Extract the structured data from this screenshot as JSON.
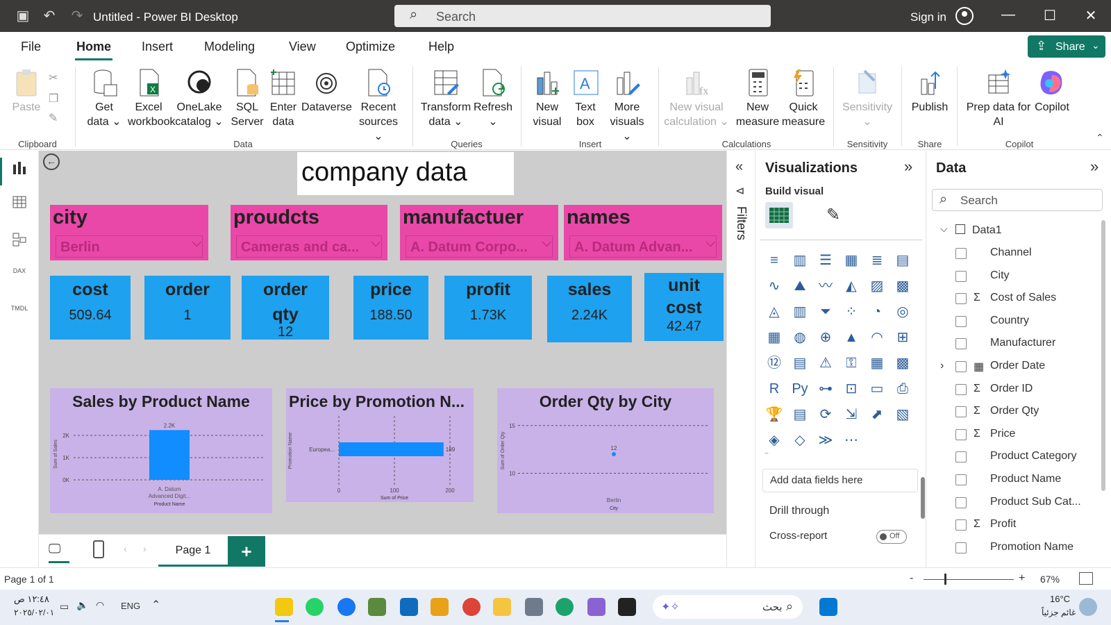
{
  "window": {
    "title": "Untitled - Power BI Desktop",
    "search_placeholder": "Search",
    "signin": "Sign in"
  },
  "menu": {
    "items": [
      "File",
      "Home",
      "Insert",
      "Modeling",
      "View",
      "Optimize",
      "Help"
    ],
    "active": "Home",
    "share": "Share"
  },
  "ribbon": {
    "buttons": {
      "paste": "Paste",
      "get_data": "Get data",
      "excel": "Excel workbook",
      "onelake": "OneLake catalog",
      "sql": "SQL Server",
      "enter_data": "Enter data",
      "dataverse": "Dataverse",
      "recent": "Recent sources",
      "transform": "Transform data",
      "refresh": "Refresh",
      "new_visual": "New visual",
      "text_box": "Text box",
      "more_visuals": "More visuals",
      "new_visual_calc": "New visual calculation",
      "new_measure": "New measure",
      "quick_measure": "Quick measure",
      "sensitivity": "Sensitivity",
      "publish": "Publish",
      "prep_data": "Prep data for AI",
      "copilot": "Copilot"
    },
    "groups": [
      "Clipboard",
      "Data",
      "Queries",
      "Insert",
      "Calculations",
      "Sensitivity",
      "Share",
      "Copilot"
    ]
  },
  "report": {
    "title": "company data",
    "slicers": [
      {
        "label": "city",
        "value": "Berlin"
      },
      {
        "label": "proudcts",
        "value": "Cameras and ca..."
      },
      {
        "label": "manufactuer",
        "value": "A. Datum Corpo..."
      },
      {
        "label": "names",
        "value": "A. Datum Advan..."
      }
    ],
    "cards": [
      {
        "label": "cost",
        "value": "509.64"
      },
      {
        "label": "order",
        "value": "1"
      },
      {
        "label": "order qty",
        "value": "12"
      },
      {
        "label": "price",
        "value": "188.50"
      },
      {
        "label": "profit",
        "value": "1.73K"
      },
      {
        "label": "sales",
        "value": "2.24K"
      },
      {
        "label": "unit cost",
        "value": "42.47"
      }
    ]
  },
  "chart_data": [
    {
      "type": "bar",
      "title": "Sales by Product Name",
      "categories": [
        "A. Datum Advanced Digit..."
      ],
      "values": [
        2240
      ],
      "data_labels": [
        "2.2K"
      ],
      "xlabel": "Product Name",
      "ylabel": "Sum of Sales",
      "yticks": [
        "0K",
        "1K",
        "2K"
      ],
      "ylim": [
        0,
        2500
      ]
    },
    {
      "type": "bar",
      "orientation": "horizontal",
      "title": "Price by Promotion N...",
      "categories": [
        "Europea..."
      ],
      "values": [
        188.5
      ],
      "data_labels": [
        "189"
      ],
      "xlabel": "Sum of Price",
      "ylabel": "Promotion Name",
      "xticks": [
        "0",
        "100",
        "200"
      ],
      "xlim": [
        0,
        200
      ]
    },
    {
      "type": "scatter",
      "title": "Order Qty by City",
      "categories": [
        "Berlin"
      ],
      "values": [
        12
      ],
      "data_labels": [
        "12"
      ],
      "xlabel": "City",
      "ylabel": "Sum of Order Qty",
      "yticks": [
        "10",
        "15"
      ],
      "ylim": [
        8,
        16
      ]
    }
  ],
  "pages": {
    "tab": "Page 1",
    "status": "Page 1 of 1",
    "zoom": "67%"
  },
  "panes": {
    "filters": "Filters",
    "visualizations": {
      "title": "Visualizations",
      "build": "Build visual",
      "add_fields": "Add data fields here",
      "drill": "Drill through",
      "cross": "Cross-report",
      "toggle": "Off"
    },
    "data": {
      "title": "Data",
      "search": "Search",
      "table": "Data1",
      "fields": [
        {
          "name": "Channel",
          "sigma": false
        },
        {
          "name": "City",
          "sigma": false
        },
        {
          "name": "Cost of Sales",
          "sigma": true
        },
        {
          "name": "Country",
          "sigma": false
        },
        {
          "name": "Manufacturer",
          "sigma": false
        },
        {
          "name": "Order Date",
          "sigma": false
        },
        {
          "name": "Order ID",
          "sigma": true
        },
        {
          "name": "Order Qty",
          "sigma": true
        },
        {
          "name": "Price",
          "sigma": true
        },
        {
          "name": "Product Category",
          "sigma": false
        },
        {
          "name": "Product Name",
          "sigma": false
        },
        {
          "name": "Product Sub Cat...",
          "sigma": false
        },
        {
          "name": "Profit",
          "sigma": true
        },
        {
          "name": "Promotion Name",
          "sigma": false
        }
      ]
    }
  },
  "taskbar": {
    "time": "١٢:٤٨ ص",
    "date": "٢٠٢٥/٠٢/٠١",
    "lang": "ENG",
    "search": "بحث",
    "temp": "16°C",
    "weather": "غائم جزئياً"
  }
}
